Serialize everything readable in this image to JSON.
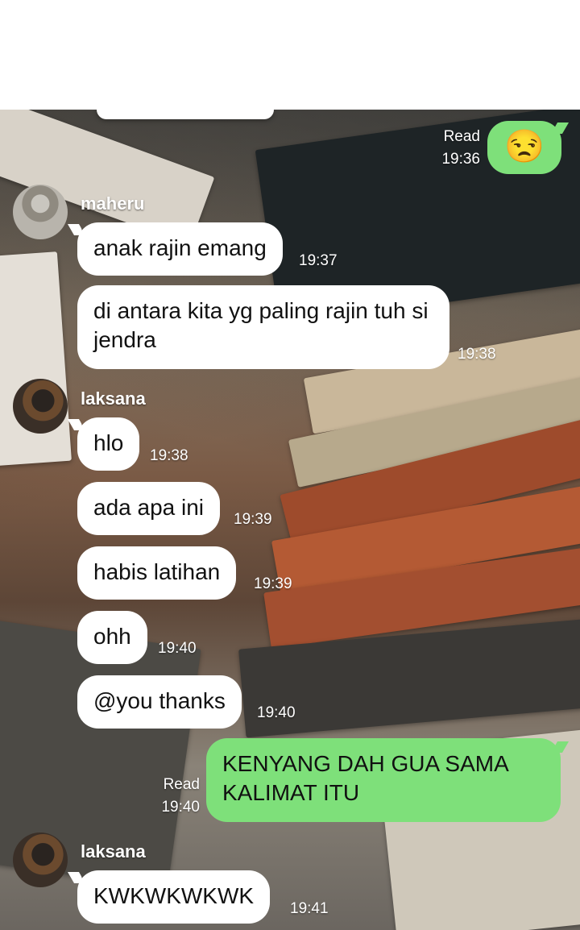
{
  "messages": [
    {
      "id": "m1",
      "sender": "me",
      "type": "emoji",
      "text": "😒",
      "read": "Read",
      "time": "19:36"
    },
    {
      "id": "m2",
      "sender": "maheru",
      "text": "anak rajin emang",
      "time": "19:37"
    },
    {
      "id": "m3",
      "sender": "maheru",
      "text": "di antara kita yg paling rajin tuh si jendra",
      "time": "19:38"
    },
    {
      "id": "m4",
      "sender": "laksana",
      "text": "hlo",
      "time": "19:38"
    },
    {
      "id": "m5",
      "sender": "laksana",
      "text": "ada apa ini",
      "time": "19:39"
    },
    {
      "id": "m6",
      "sender": "laksana",
      "text": "habis latihan",
      "time": "19:39"
    },
    {
      "id": "m7",
      "sender": "laksana",
      "text": "ohh",
      "time": "19:40"
    },
    {
      "id": "m8",
      "sender": "laksana",
      "text": "@you thanks",
      "time": "19:40"
    },
    {
      "id": "m9",
      "sender": "me",
      "text": "KENYANG DAH GUA SAMA KALIMAT ITU",
      "read": "Read",
      "time": "19:40"
    },
    {
      "id": "m10",
      "sender": "laksana",
      "text": "KWKWKWKWK",
      "time": "19:41"
    }
  ],
  "senders": {
    "maheru": {
      "name": "maheru"
    },
    "laksana_1": {
      "name": "laksana"
    },
    "laksana_2": {
      "name": "laksana"
    }
  },
  "colors": {
    "outgoing_bubble": "#7ee07a",
    "incoming_bubble": "#ffffff",
    "time_text": "#ffffff"
  }
}
